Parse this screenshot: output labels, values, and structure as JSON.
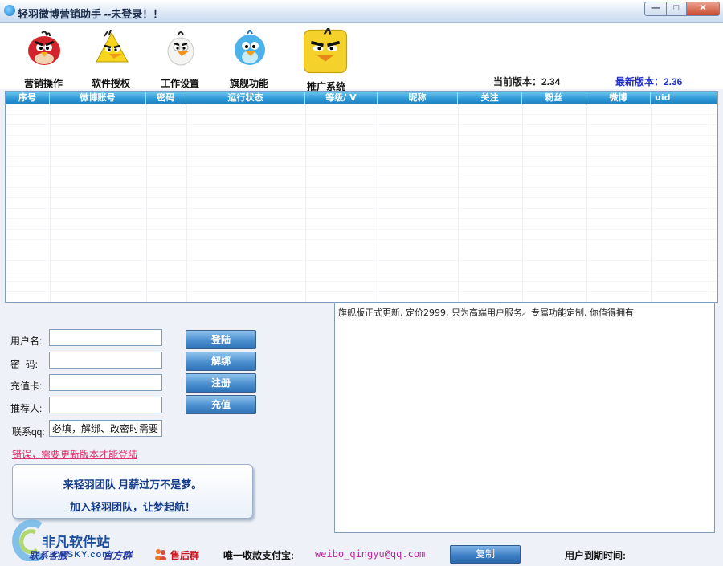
{
  "window": {
    "title": "轻羽微博营销助手 --未登录！！",
    "min": "0",
    "max": "1",
    "close": "r"
  },
  "toolbar": {
    "items": [
      {
        "label": "营销操作",
        "icon": "red-bird-icon"
      },
      {
        "label": "软件授权",
        "icon": "yellow-bird-icon"
      },
      {
        "label": "工作设置",
        "icon": "white-bird-icon"
      },
      {
        "label": "旗舰功能",
        "icon": "blue-bird-icon"
      },
      {
        "label": "推广系统",
        "icon": "yellow-square-bird-icon"
      }
    ],
    "current_version": "当前版本：2.34",
    "latest_version": "最新版本：2.36"
  },
  "table": {
    "columns": [
      "序号",
      "微博账号",
      "密码",
      "运行状态",
      "等级/ V",
      "昵称",
      "关注",
      "粉丝",
      "微博",
      "uid"
    ],
    "rows": []
  },
  "login": {
    "username_label": "用户名:",
    "password_label": "密  码:",
    "card_label": "充值卡:",
    "referrer_label": "推荐人:",
    "qq_label": "联系qq:",
    "username_value": "",
    "password_value": "",
    "card_value": "",
    "referrer_value": "",
    "qq_value": "必填，解绑、改密时需要",
    "login_button": "登陆",
    "unbind_button": "解绑",
    "register_button": "注册",
    "recharge_button": "充值"
  },
  "error_link": "错误，需要更新版本才能登陆",
  "banner": {
    "line1": "来轻羽团队  月薪过万不是梦。",
    "line2": "加入轻羽团队，让梦起航！"
  },
  "notice": {
    "text": "旗舰版正式更新, 定价2999, 只为高端用户服务。专属功能定制, 你值得拥有"
  },
  "footer": {
    "contact": "联系客服",
    "official": "官方群",
    "aftersale": "售后群",
    "payment_label": "唯一收款支付宝:",
    "payment_email": "weibo_qingyu@qq.com",
    "copy_button": "复制",
    "expiry_label": "用户到期时间:"
  },
  "watermark": {
    "brand": "非凡软件站",
    "domain": "CRSKY.com"
  },
  "colors": {
    "header_blue": "#2f98d6",
    "latest_version": "#2030c8",
    "error_pink": "#d9336b",
    "email_purple": "#c0209a"
  }
}
